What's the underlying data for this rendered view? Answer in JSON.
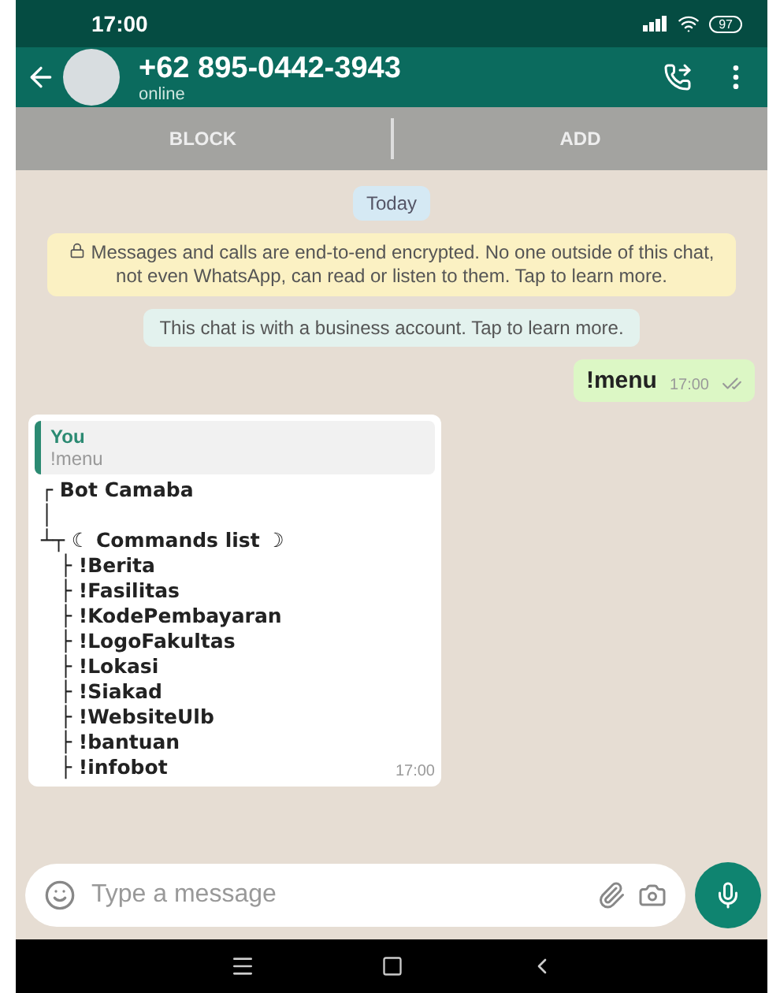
{
  "status_bar": {
    "time": "17:00",
    "battery": "97"
  },
  "header": {
    "title": "+62 895-0442-3943",
    "subtitle": "online"
  },
  "action_bar": {
    "buttons": [
      "BLOCK",
      "ADD"
    ]
  },
  "chat": {
    "date": "Today",
    "encryption_notice": "Messages and calls are end-to-end encrypted. No one outside of this chat, not even WhatsApp, can read or listen to them. Tap to learn more.",
    "business_notice": "This chat is with a business account. Tap to learn more.",
    "sent": {
      "text": "!menu",
      "time": "17:00"
    },
    "reply": {
      "quote_author": "You",
      "quote_text": "!menu",
      "title": "┌ Bot Camaba",
      "connector": "│",
      "list_title": "┴┬ ☾ Commands list ☽",
      "commands": [
        "├ !Berita",
        "├ !Fasilitas",
        "├ !KodePembayaran",
        "├ !LogoFakultas",
        "├ !Lokasi",
        "├ !Siakad",
        "├ !WebsiteUlb",
        "├ !bantuan",
        "├ !infobot"
      ],
      "time": "17:00"
    }
  },
  "composer": {
    "placeholder": "Type a message"
  }
}
